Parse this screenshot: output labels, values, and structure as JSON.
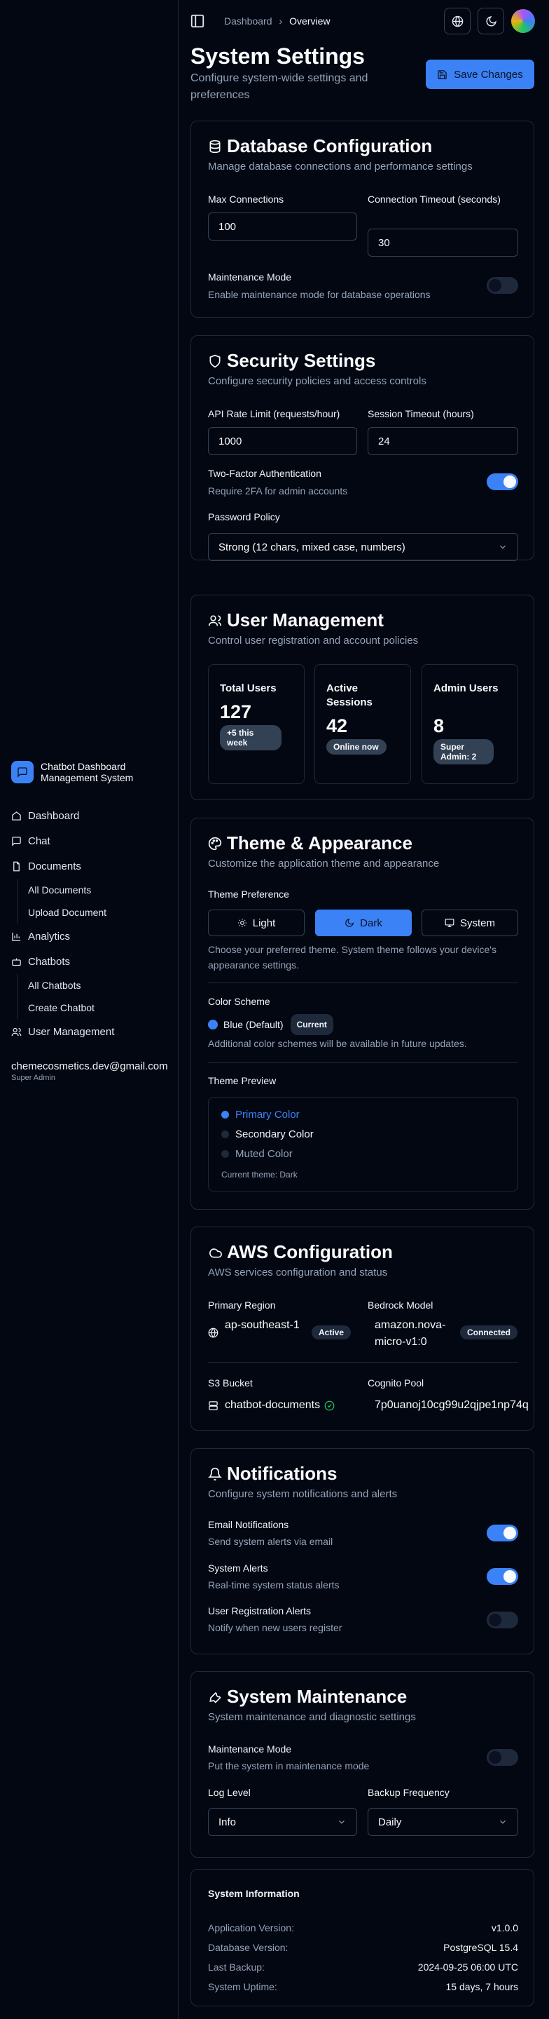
{
  "app": {
    "name": "Chatbot Dashboard Management System"
  },
  "breadcrumb": {
    "home": "Dashboard",
    "current": "Overview"
  },
  "sidebar": {
    "items": [
      {
        "label": "Dashboard"
      },
      {
        "label": "Chat"
      },
      {
        "label": "Documents"
      },
      {
        "label": "All Documents"
      },
      {
        "label": "Upload Document"
      },
      {
        "label": "Analytics"
      },
      {
        "label": "Chatbots"
      },
      {
        "label": "All Chatbots"
      },
      {
        "label": "Create Chatbot"
      },
      {
        "label": "User Management"
      }
    ],
    "user": {
      "email": "chemecosmetics.dev@gmail.com",
      "role": "Super Admin"
    }
  },
  "page": {
    "title": "System Settings",
    "subtitle": "Configure system-wide settings and preferences",
    "save_label": "Save Changes"
  },
  "database": {
    "title": "Database Configuration",
    "subtitle": "Manage database connections and performance settings",
    "max_conn_label": "Max Connections",
    "max_conn_value": "100",
    "timeout_label": "Connection Timeout (seconds)",
    "timeout_value": "30",
    "maintenance_label": "Maintenance Mode",
    "maintenance_help": "Enable maintenance mode for database operations",
    "maintenance_on": false
  },
  "security": {
    "title": "Security Settings",
    "subtitle": "Configure security policies and access controls",
    "rate_label": "API Rate Limit (requests/hour)",
    "rate_value": "1000",
    "session_label": "Session Timeout (hours)",
    "session_value": "24",
    "twofa_label": "Two-Factor Authentication",
    "twofa_help": "Require 2FA for admin accounts",
    "twofa_on": true,
    "policy_label": "Password Policy",
    "policy_value": "Strong (12 chars, mixed case, numbers)"
  },
  "users": {
    "title": "User Management",
    "subtitle": "Control user registration and account policies",
    "stats": [
      {
        "title": "Total Users",
        "value": "127",
        "badge": "+5 this week"
      },
      {
        "title": "Active Sessions",
        "value": "42",
        "badge": "Online now"
      },
      {
        "title": "Admin Users",
        "value": "8",
        "badge": "Super Admin: 2"
      }
    ]
  },
  "theme": {
    "title": "Theme & Appearance",
    "subtitle": "Customize the application theme and appearance",
    "pref_label": "Theme Preference",
    "options": [
      "Light",
      "Dark",
      "System"
    ],
    "selected": "Dark",
    "pref_help": "Choose your preferred theme. System theme follows your device's appearance settings.",
    "scheme_label": "Color Scheme",
    "scheme_value": "Blue (Default)",
    "scheme_badge": "Current",
    "scheme_help": "Additional color schemes will be available in future updates.",
    "preview_label": "Theme Preview",
    "preview_items": [
      "Primary Color",
      "Secondary Color",
      "Muted Color"
    ],
    "preview_current": "Current theme: Dark",
    "accent_color": "#3b82f6"
  },
  "aws": {
    "title": "AWS Configuration",
    "subtitle": "AWS services configuration and status",
    "region_label": "Primary Region",
    "region_value": "ap-southeast-1",
    "region_badge": "Active",
    "model_label": "Bedrock Model",
    "model_value": "amazon.nova-micro-v1:0",
    "model_badge": "Connected",
    "s3_label": "S3 Bucket",
    "s3_value": "chatbot-documents",
    "cognito_label": "Cognito Pool",
    "cognito_value": "7p0uanoj10cg99u2qjpe1np74q"
  },
  "notifications": {
    "title": "Notifications",
    "subtitle": "Configure system notifications and alerts",
    "items": [
      {
        "label": "Email Notifications",
        "help": "Send system alerts via email",
        "on": true
      },
      {
        "label": "System Alerts",
        "help": "Real-time system status alerts",
        "on": true
      },
      {
        "label": "User Registration Alerts",
        "help": "Notify when new users register",
        "on": false
      }
    ]
  },
  "maintenance": {
    "title": "System Maintenance",
    "subtitle": "System maintenance and diagnostic settings",
    "mode_label": "Maintenance Mode",
    "mode_help": "Put the system in maintenance mode",
    "mode_on": false,
    "log_label": "Log Level",
    "log_value": "Info",
    "backup_label": "Backup Frequency",
    "backup_value": "Daily"
  },
  "sysinfo": {
    "title": "System Information",
    "rows": [
      {
        "key": "Application Version:",
        "value": "v1.0.0"
      },
      {
        "key": "Database Version:",
        "value": "PostgreSQL 15.4"
      },
      {
        "key": "Last Backup:",
        "value": "2024-09-25 06:00 UTC"
      },
      {
        "key": "System Uptime:",
        "value": "15 days, 7 hours"
      }
    ]
  }
}
